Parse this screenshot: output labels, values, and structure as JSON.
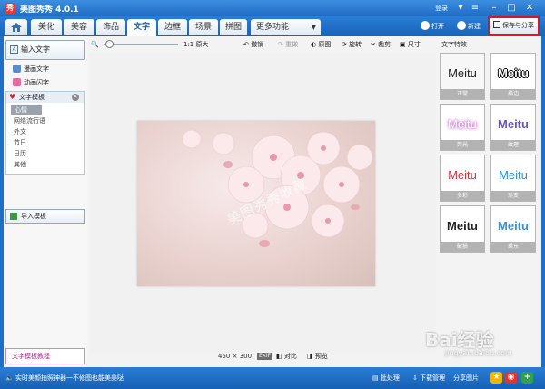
{
  "window": {
    "title": "美图秀秀 4.0.1",
    "login": "登录"
  },
  "nav": {
    "tabs": [
      "美化",
      "美容",
      "饰品",
      "文字",
      "边框",
      "场景",
      "拼图"
    ],
    "active_tab": "文字",
    "more": "更多功能",
    "open": "打开",
    "new": "新建",
    "save_share": "保存与分享"
  },
  "sidebar": {
    "input_text": "输入文字",
    "comic_text": "漫画文字",
    "animated_text": "动画闪字",
    "template_title": "文字模板",
    "template_items": [
      "心情",
      "网络流行语",
      "外文",
      "节日",
      "日历",
      "其他"
    ],
    "import_template": "导入模板",
    "tutorial": "文字模板教程"
  },
  "toolbar": {
    "original_size": "1:1 原大",
    "undo": "撤销",
    "redo": "重做",
    "original_image": "原图",
    "rotate": "旋转",
    "crop": "裁剪",
    "size": "尺寸"
  },
  "canvas": {
    "watermark": "美图秀秀收藏",
    "dimensions": "450 × 300",
    "exif": "EXIF",
    "compare": "对比",
    "preview": "预览"
  },
  "effects": {
    "title": "文字特效",
    "items": [
      {
        "word": "Meitu",
        "label": "正常"
      },
      {
        "word": "Meitu",
        "label": "描边"
      },
      {
        "word": "Meitu",
        "label": "荧光"
      },
      {
        "word": "Meitu",
        "label": "纹理"
      },
      {
        "word": "Meitu",
        "label": "多彩"
      },
      {
        "word": "Meitu",
        "label": "渐变"
      },
      {
        "word": "Meitu",
        "label": "破损"
      },
      {
        "word": "Meitu",
        "label": "乘东"
      }
    ]
  },
  "status": {
    "tip": "实时美颜拍照神器一不修图也能美美哒",
    "batch": "批处理",
    "download_mgr": "下载管理",
    "share_pic": "分享图片"
  },
  "overlay": {
    "baidu": "Bai经验",
    "site": "jingyan.baidu.com"
  },
  "colors": {
    "accent": "#1f6cc4",
    "highlight_border": "#e0141b",
    "tutorial": "#b2268f"
  }
}
